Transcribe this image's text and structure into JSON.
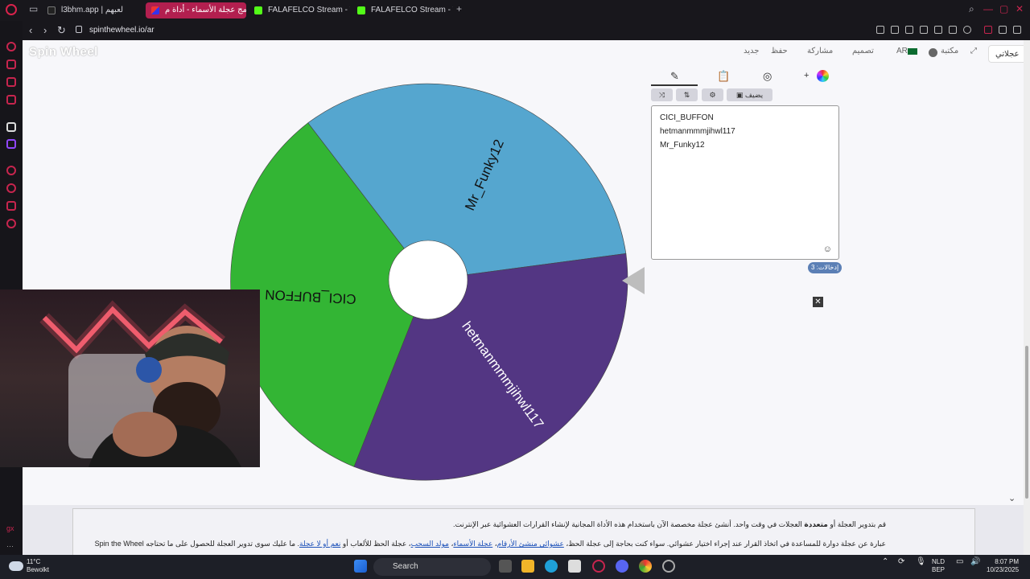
{
  "browser": {
    "tabs": [
      {
        "label": "l3bhm.app | لعبهم"
      },
      {
        "label": "برنامج عجلة الأسماء - أداة م..."
      },
      {
        "label": "FALAFELCO Stream - Wat"
      },
      {
        "label": "FALAFELCO Stream - Wat"
      }
    ],
    "new_tab": "+",
    "url": "spinthewheel.io/ar"
  },
  "site": {
    "logo": "Spin Wheel",
    "nav": {
      "my_wheel": "عجلاتي",
      "library": "مكتبة",
      "lang": "AR",
      "design": "تصميم",
      "share": "مشاركة",
      "save": "حفظ",
      "new": "جديد"
    }
  },
  "panel": {
    "add_label": "يضيف",
    "plus": "+",
    "entries": [
      "CICI_BUFFON",
      "hetmanmmmjihwl117",
      "Mr_Funky12"
    ],
    "entries_count": "إدخالات: 3"
  },
  "wheel": {
    "segments": [
      {
        "label": "Mr_Funky12",
        "color": "#55a6cf"
      },
      {
        "label": "hetmanmmmjihwl117",
        "color": "#533683"
      },
      {
        "label": "CICI_BUFFON",
        "color": "#33b534"
      }
    ]
  },
  "footer": {
    "line1_a": "قم بتدوير العجلة أو ",
    "line1_b": "متعددة",
    "line1_c": " العجلات في وقت واحد. أنشئ عجلة مخصصة الآن باستخدام هذه الأداة المجانية لإنشاء القرارات العشوائية عبر الإنترنت.",
    "line2_a": "عبارة عن عجلة دوارة للمساعدة في اتخاذ القرار عند إجراء اختيار عشوائي. سواء كنت بحاجة إلى عجلة الحظ، ",
    "line2_link1": "عشوائي منشئ الأرقام",
    "line2_sep1": "، ",
    "line2_link2": "عجلة الأسماء",
    "line2_sep2": "، ",
    "line2_link3": "مولد السحب",
    "line2_b": "، عجلة الحظ للألعاب أو ",
    "line2_link4": "نعم أو لا عجلة",
    "line2_c": ". ما عليك سوى تدوير العجلة للحصول على ما تحتاجه Spin the Wheel"
  },
  "taskbar": {
    "temp": "11°C",
    "weather": "Bewolkt",
    "search": "Search",
    "lang1": "NLD",
    "lang2": "BEP",
    "time": "8:07 PM",
    "date": "10/23/2025"
  },
  "colors": {
    "accent": "#b21f4f",
    "entries_badge": "#5b7fb5"
  }
}
